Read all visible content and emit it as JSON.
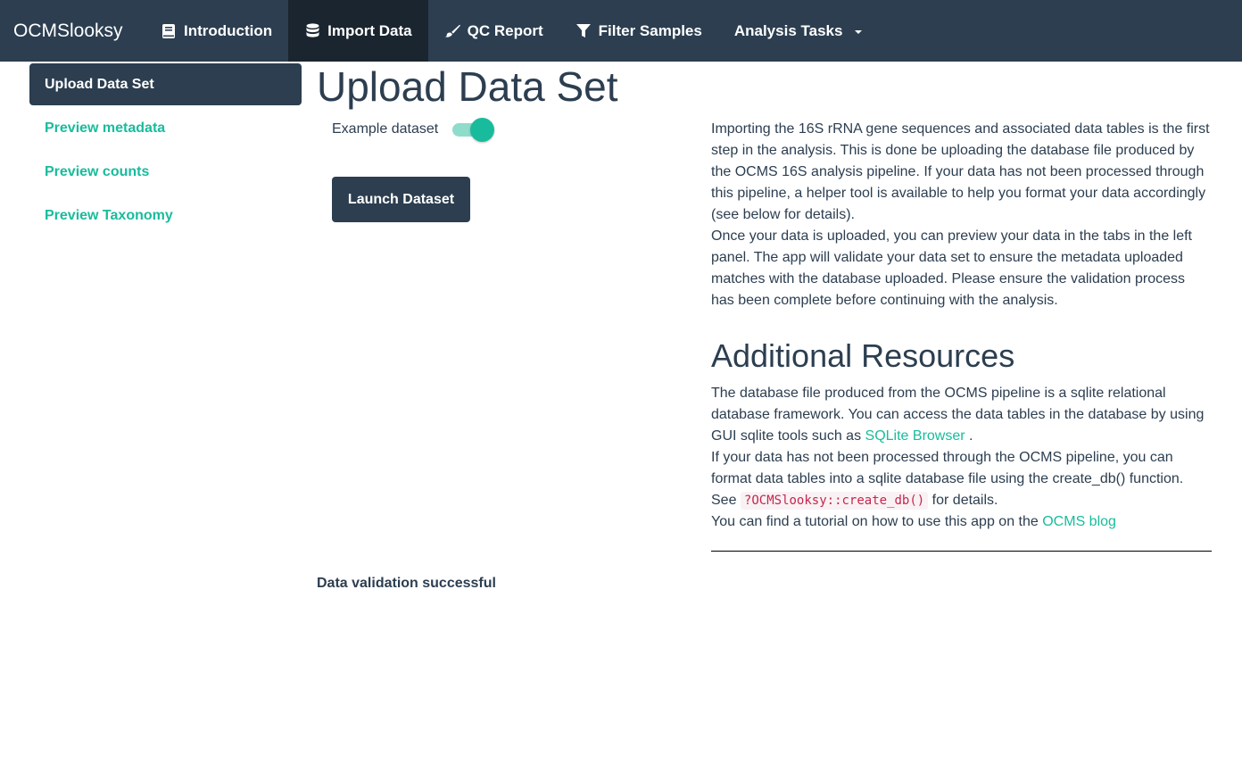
{
  "navbar": {
    "brand": "OCMSlooksy",
    "items": [
      {
        "label": "Introduction",
        "icon": "book-icon"
      },
      {
        "label": "Import Data",
        "icon": "database-icon",
        "active": true
      },
      {
        "label": "QC Report",
        "icon": "paint-brush-icon"
      },
      {
        "label": "Filter Samples",
        "icon": "filter-icon"
      },
      {
        "label": "Analysis Tasks",
        "icon": "caret-down-icon"
      }
    ]
  },
  "sidebar": {
    "items": [
      {
        "label": "Upload Data Set",
        "active": true
      },
      {
        "label": "Preview metadata"
      },
      {
        "label": "Preview counts"
      },
      {
        "label": "Preview Taxonomy"
      }
    ]
  },
  "main": {
    "title": "Upload Data Set",
    "switch_label": "Example dataset",
    "switch_on": true,
    "launch_label": "Launch Dataset",
    "validation_text": "Data validation successful"
  },
  "info": {
    "p1": "Importing the 16S rRNA gene sequences and associated data tables is the first step in the analysis. This is done be uploading the database file produced by the OCMS 16S analysis pipeline. If your data has not been processed through this pipeline, a helper tool is available to help you format your data accordingly (see below for details).",
    "p2": "Once your data is uploaded, you can preview your data in the tabs in the left panel. The app will validate your data set to ensure the metadata uploaded matches with the database uploaded. Please ensure the validation process has been complete before continuing with the analysis.",
    "resources_title": "Additional Resources",
    "r1_text": "The database file produced from the OCMS pipeline is a sqlite relational database framework. You can access the data tables in the database by using GUI sqlite tools such as",
    "r1_link": "SQLite Browser",
    "r1_end": ".",
    "r2_text": "If your data has not been processed through the OCMS pipeline, you can format data tables into a sqlite database file using the create_db() function. See",
    "r2_code": "?OCMSlooksy::create_db()",
    "r2_end": "for details.",
    "r3_text": "You can find a tutorial on how to use this app on the",
    "r3_link": "OCMS blog"
  },
  "colors": {
    "navbar": "#2c3e50",
    "accent": "#18bc9c",
    "active_nav": "#1a252f"
  }
}
